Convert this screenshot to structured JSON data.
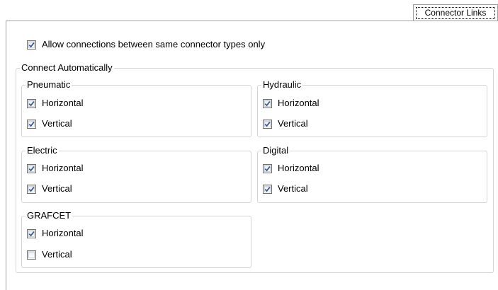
{
  "tab": {
    "label": "Connector Links"
  },
  "allow_same_types": {
    "label": "Allow connections between same connector types only",
    "checked": true
  },
  "connect_automatically": {
    "title": "Connect Automatically",
    "groups": [
      {
        "title": "Pneumatic",
        "horizontal": {
          "label": "Horizontal",
          "checked": true
        },
        "vertical": {
          "label": "Vertical",
          "checked": true
        }
      },
      {
        "title": "Hydraulic",
        "horizontal": {
          "label": "Horizontal",
          "checked": true
        },
        "vertical": {
          "label": "Vertical",
          "checked": true
        }
      },
      {
        "title": "Electric",
        "horizontal": {
          "label": "Horizontal",
          "checked": true
        },
        "vertical": {
          "label": "Vertical",
          "checked": true
        }
      },
      {
        "title": "Digital",
        "horizontal": {
          "label": "Horizontal",
          "checked": true
        },
        "vertical": {
          "label": "Vertical",
          "checked": true
        }
      },
      {
        "title": "GRAFCET",
        "horizontal": {
          "label": "Horizontal",
          "checked": true
        },
        "vertical": {
          "label": "Vertical",
          "checked": false
        }
      }
    ]
  }
}
